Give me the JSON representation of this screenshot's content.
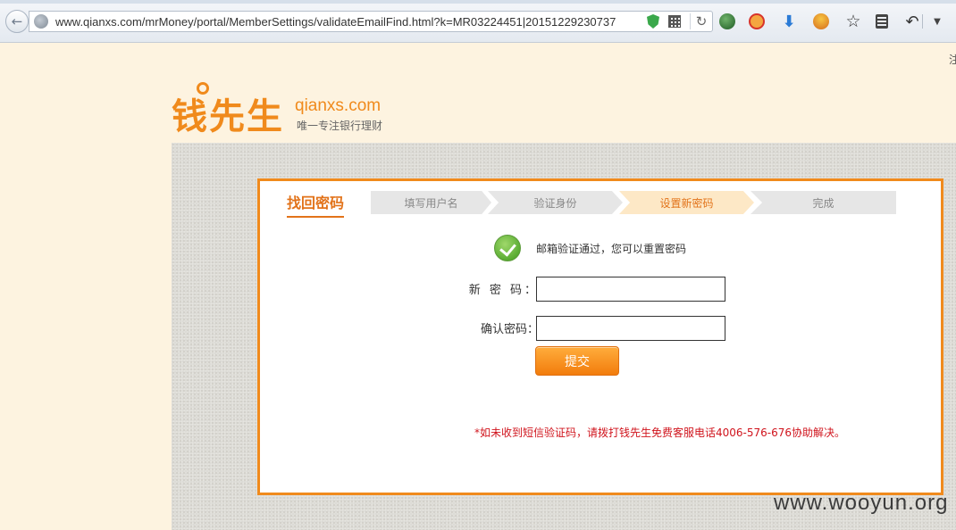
{
  "browser": {
    "url": "www.qianxs.com/mrMoney/portal/MemberSettings/validateEmailFind.html?k=MR03224451|20151229230737",
    "icons": [
      "back-icon",
      "globe-icon",
      "shield-icon",
      "qrcode-icon",
      "reload-icon",
      "green-extension-icon",
      "adblock-icon",
      "download-icon",
      "face-extension-icon",
      "bookmark-star-icon",
      "reading-list-icon",
      "undo-icon",
      "menu-dropdown-icon"
    ]
  },
  "page": {
    "top_right_text": "注",
    "logo": {
      "name_cn": "钱先生",
      "domain": "qianxs.com",
      "slogan": "唯一专注银行理财"
    },
    "card": {
      "title": "找回密码",
      "steps": [
        {
          "label": "填写用户名",
          "active": false
        },
        {
          "label": "验证身份",
          "active": false
        },
        {
          "label": "设置新密码",
          "active": true
        },
        {
          "label": "完成",
          "active": false
        }
      ],
      "success_message": "邮箱验证通过，您可以重置密码",
      "new_password_label": "新 密 码：",
      "confirm_password_label": "确认密码：",
      "new_password_value": "",
      "confirm_password_value": "",
      "submit_label": "提交",
      "notice": "*如未收到短信验证码，请拨打钱先生免费客服电话4006-576-676协助解决。"
    },
    "watermark": "www.wooyun.org"
  },
  "colors": {
    "brand_orange": "#f08a1c",
    "active_step_bg": "#fde8c6",
    "notice_red": "#d0141d",
    "success_green": "#3e9a1c"
  }
}
